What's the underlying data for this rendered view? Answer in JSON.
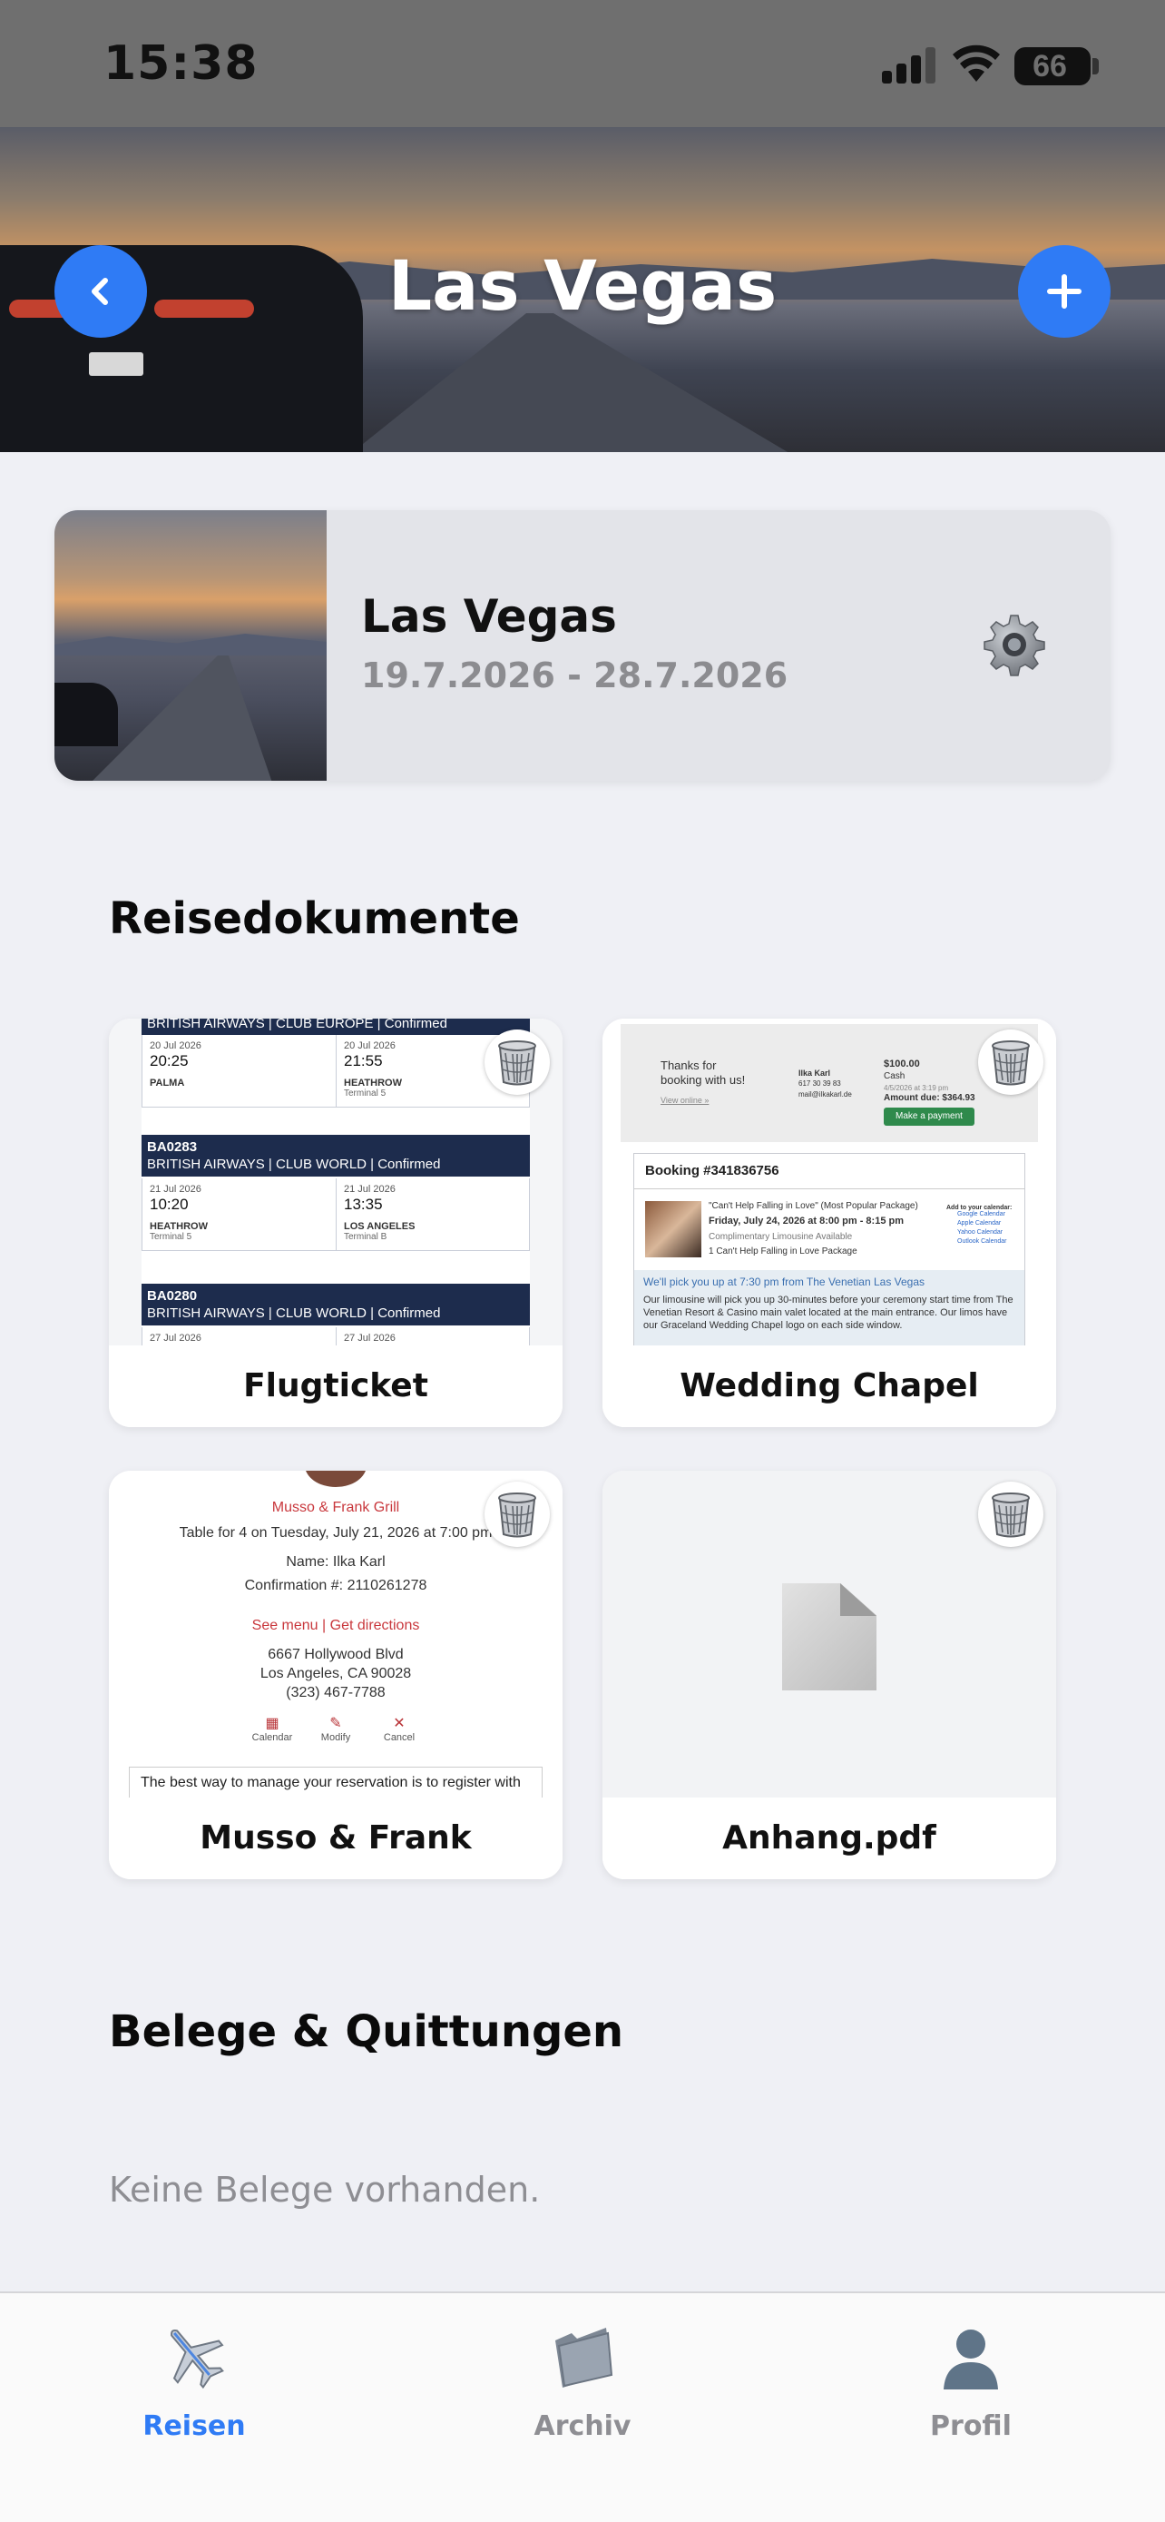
{
  "status_bar": {
    "time": "15:38",
    "battery": "66"
  },
  "header": {
    "title": "Las Vegas",
    "back_icon": "chevron-left-icon",
    "add_icon": "plus-icon"
  },
  "trip": {
    "name": "Las Vegas",
    "dates": "19.7.2026 - 28.7.2026"
  },
  "sections": {
    "documents_title": "Reisedokumente",
    "receipts_title": "Belege & Quittungen",
    "receipts_empty": "Keine Belege vorhanden."
  },
  "documents": [
    {
      "label": "Flugticket",
      "preview": {
        "bar_top": "BRITISH AIRWAYS | CLUB EUROPE | Confirmed",
        "seg1": {
          "dep_date": "20 Jul 2026",
          "dep_time": "20:25",
          "dep_place": "PALMA",
          "dep_term": "",
          "arr_date": "20 Jul 2026",
          "arr_time": "21:55",
          "arr_place": "HEATHROW",
          "arr_term": "Terminal 5"
        },
        "flight2_code": "BA0283",
        "flight2_line": "BRITISH AIRWAYS | CLUB WORLD | Confirmed",
        "seg2": {
          "dep_date": "21 Jul 2026",
          "dep_time": "10:20",
          "dep_place": "HEATHROW",
          "dep_term": "Terminal 5",
          "arr_date": "21 Jul 2026",
          "arr_time": "13:35",
          "arr_place": "LOS ANGELES",
          "arr_term": "Terminal B"
        },
        "flight3_code": "BA0280",
        "flight3_line": "BRITISH AIRWAYS | CLUB WORLD | Confirmed",
        "seg3": {
          "dep_date": "27 Jul 2026",
          "arr_date": "27 Jul 2026"
        }
      }
    },
    {
      "label": "Wedding Chapel",
      "preview": {
        "thanks": "Thanks for booking with us!",
        "view_online": "View online »",
        "customer_name": "Ilka Karl",
        "customer_phone": "617 30 39 83",
        "customer_email": "mail@ilkakarl.de",
        "amount": "$100.00",
        "payment_method": "Cash",
        "paid_date": "4/5/2026 at 3:19 pm",
        "amount_due": "Amount due: $364.93",
        "pay_button": "Make a payment",
        "booking_no": "Booking #341836756",
        "package": "\"Can't Help Falling in Love\" (Most Popular Package)",
        "datetime": "Friday, July 24, 2026 at 8:00 pm - 8:15 pm",
        "limo": "Complimentary Limousine Available",
        "qty_line": "1 Can't Help Falling in Love Package",
        "add_calendar": "Add to your calendar:",
        "calendars": [
          "Google Calendar",
          "Apple Calendar",
          "Yahoo Calendar",
          "Outlook Calendar"
        ],
        "pickup": "We'll pick you up at 7:30 pm from The Venetian Las Vegas",
        "pickup_detail": "Our limousine will pick you up 30-minutes before your ceremony start time from The Venetian Resort & Casino main valet located at the main entrance. Our limos have our Graceland Wedding Chapel logo on each side window."
      }
    },
    {
      "label": "Musso & Frank",
      "preview": {
        "restaurant": "Musso & Frank Grill",
        "table": "Table for 4 on Tuesday, July 21, 2026 at 7:00 pm",
        "name": "Name: Ilka Karl",
        "confirmation": "Confirmation #: 2110261278",
        "links": "See menu | Get directions",
        "address1": "6667 Hollywood Blvd",
        "address2": "Los Angeles, CA 90028",
        "phone": "(323) 467-7788",
        "actions": [
          "Calendar",
          "Modify",
          "Cancel"
        ],
        "footer": "The best way to manage your reservation is to register with"
      }
    },
    {
      "label": "Anhang.pdf",
      "preview": {
        "icon": "document-icon"
      }
    }
  ],
  "tabbar": {
    "items": [
      {
        "label": "Reisen",
        "icon": "airplane-icon",
        "active": true
      },
      {
        "label": "Archiv",
        "icon": "folder-icon",
        "active": false
      },
      {
        "label": "Profil",
        "icon": "person-icon",
        "active": false
      }
    ]
  },
  "colors": {
    "accent": "#2f7bf5",
    "background": "#eff0f5",
    "muted": "#8e8e93",
    "flight_bar": "#1d2c4d",
    "restaurant_red": "#c9383d"
  }
}
